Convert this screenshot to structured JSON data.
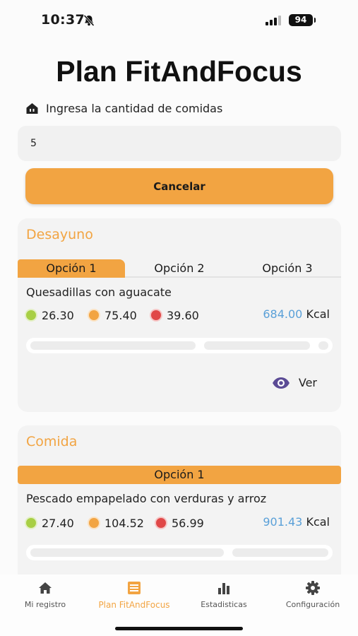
{
  "status_bar": {
    "time": "10:37",
    "battery": "94"
  },
  "app_title": "Plan FitAndFocus",
  "form": {
    "qty_label": "Ingresa la cantidad de comidas",
    "qty_value": "5",
    "cancel_label": "Cancelar"
  },
  "meals": [
    {
      "title": "Desayuno",
      "tabs": [
        "Opción 1",
        "Opción 2",
        "Opción 3"
      ],
      "active_tab": 0,
      "dish": "Quesadillas con aguacate",
      "macros": [
        "26.30",
        "75.40",
        "39.60"
      ],
      "kcal": "684.00",
      "kcal_unit": "Kcal",
      "view_label": "Ver"
    },
    {
      "title": "Comida",
      "tabs": [
        "Opción 1"
      ],
      "active_tab": 0,
      "dish": "Pescado empapelado con verduras y arroz",
      "macros": [
        "27.40",
        "104.52",
        "56.99"
      ],
      "kcal": "901.43",
      "kcal_unit": "Kcal"
    }
  ],
  "bottom_nav": [
    {
      "label": "Mi registro",
      "icon": "home-icon",
      "active": false
    },
    {
      "label": "Plan FitAndFocus",
      "icon": "list-icon",
      "active": true
    },
    {
      "label": "Estadisticas",
      "icon": "bar-chart-icon",
      "active": false
    },
    {
      "label": "Configuración",
      "icon": "gear-icon",
      "active": false
    }
  ],
  "colors": {
    "accent": "#f2a442",
    "kcal": "#5aa0d8",
    "protein": "#a8cf45",
    "carbs": "#f2a442",
    "fat": "#e04848"
  }
}
